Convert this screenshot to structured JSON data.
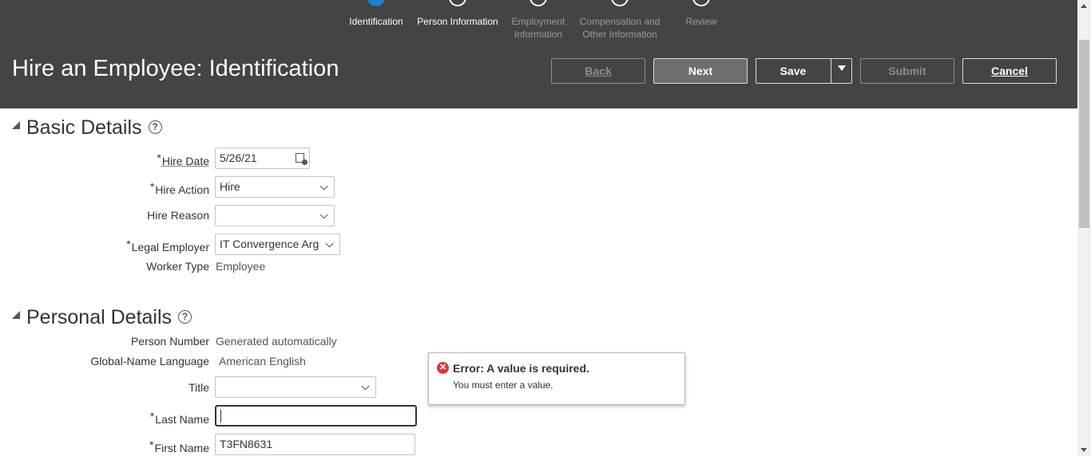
{
  "train": [
    {
      "line1": "Identification",
      "line2": ""
    },
    {
      "line1": "Person Information",
      "line2": ""
    },
    {
      "line1": "Employment",
      "line2": "Information"
    },
    {
      "line1": "Compensation and",
      "line2": "Other Information"
    },
    {
      "line1": "Review",
      "line2": ""
    }
  ],
  "header": {
    "title": "Hire an Employee: Identification",
    "buttons": {
      "back": "Back",
      "next": "Next",
      "save": "Save",
      "submit": "Submit",
      "cancel": "Cancel"
    }
  },
  "basic_details": {
    "title": "Basic Details",
    "help_icon": "help-circle-icon",
    "hire_date": {
      "label": "Hire Date",
      "value": "5/26/21",
      "required": "*"
    },
    "hire_action": {
      "label": "Hire Action",
      "value": "Hire",
      "required": "*"
    },
    "hire_reason": {
      "label": "Hire Reason",
      "value": ""
    },
    "legal_employer": {
      "label": "Legal Employer",
      "value": "IT Convergence Arg",
      "required": "*"
    },
    "worker_type": {
      "label": "Worker Type",
      "value": "Employee"
    }
  },
  "personal_details": {
    "title": "Personal Details",
    "help_icon": "help-circle-icon",
    "person_number": {
      "label": "Person Number",
      "value": "Generated automatically"
    },
    "global_name_language": {
      "label": "Global-Name Language",
      "value": "American English"
    },
    "title_field": {
      "label": "Title",
      "value": ""
    },
    "last_name": {
      "label": "Last Name",
      "value": "",
      "required": "*"
    },
    "first_name": {
      "label": "First Name",
      "value": "T3FN8631",
      "required": "*"
    }
  },
  "error_popup": {
    "icon": "error-icon",
    "title": "Error: A value is required.",
    "message": "You must enter a value."
  },
  "colors": {
    "header_bg": "#444444",
    "error": "#d9363e",
    "active_step": "#1f7ed1"
  }
}
